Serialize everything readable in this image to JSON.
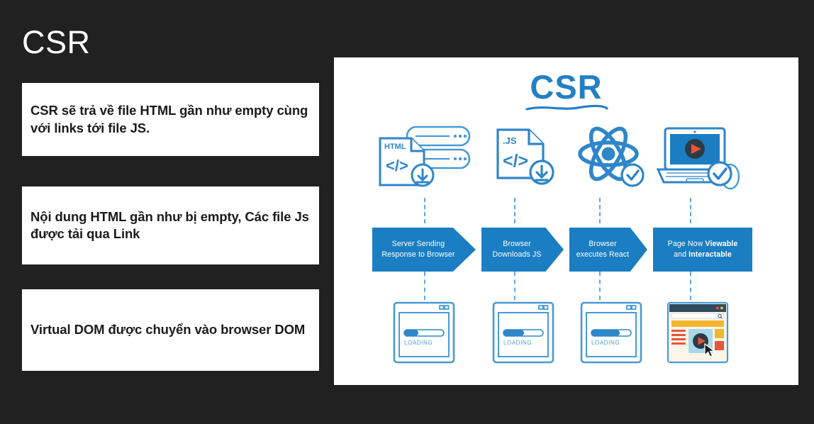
{
  "slide": {
    "title": "CSR",
    "background_color": "#212121"
  },
  "bullets": [
    {
      "text": "CSR sẽ trả về file HTML gần như empty cùng với links tới file JS."
    },
    {
      "text": "Nội dung HTML gần như bị empty, Các file Js được tải qua Link"
    },
    {
      "text": "Virtual DOM được chuyển vào browser DOM"
    }
  ],
  "diagram": {
    "logo": "CSR",
    "accent_color": "#2380c4",
    "banner_color": "#1b7ec2",
    "play_color": "#e8553a",
    "steps": [
      {
        "icon": "html-file-server-icon",
        "file_label": "HTML",
        "code_glyph": "</>",
        "banner_lines": [
          "Server Sending",
          "Response to Browser"
        ],
        "banner_shape": "arrow",
        "browser": "loading",
        "loading_label": "LOADING",
        "progress_percent": 35
      },
      {
        "icon": "js-file-icon",
        "file_label": ".JS",
        "code_glyph": "</>",
        "banner_lines": [
          "Browser",
          "Downloads JS"
        ],
        "banner_shape": "arrow",
        "browser": "loading",
        "loading_label": "LOADING",
        "progress_percent": 52
      },
      {
        "icon": "react-atom-icon",
        "file_label": "",
        "code_glyph": "",
        "banner_lines": [
          "Browser",
          "executes React"
        ],
        "banner_shape": "arrow",
        "browser": "loading",
        "loading_label": "LOADING",
        "progress_percent": 72
      },
      {
        "icon": "laptop-play-icon",
        "file_label": "",
        "code_glyph": "",
        "banner_lines": [
          "Page Now ",
          "and "
        ],
        "banner_bold": [
          "Viewable",
          "Interactable"
        ],
        "banner_shape": "rectangle",
        "browser": "rendered-page",
        "loading_label": "",
        "progress_percent": 100
      }
    ]
  }
}
